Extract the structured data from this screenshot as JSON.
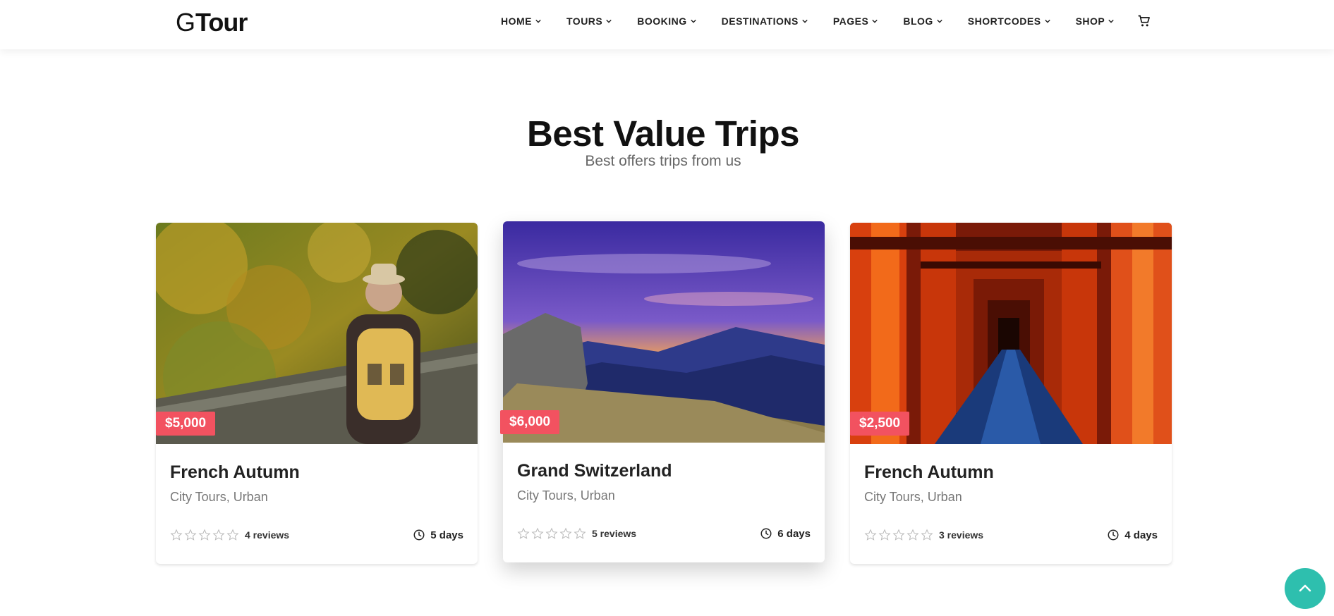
{
  "header": {
    "logo_prefix": "G",
    "logo_suffix": "Tour",
    "nav": [
      "HOME",
      "TOURS",
      "BOOKING",
      "DESTINATIONS",
      "PAGES",
      "BLOG",
      "SHORTCODES",
      "SHOP"
    ],
    "cart_icon": "shopping-cart-icon"
  },
  "section": {
    "title": "Best Value Trips",
    "subtitle": "Best offers trips from us"
  },
  "cards": [
    {
      "price": "$5,000",
      "title": "French Autumn",
      "categories": "City Tours, Urban",
      "rating": 0,
      "reviews": "4 reviews",
      "duration": "5 days",
      "image": "hiker-in-autumn-forest"
    },
    {
      "price": "$6,000",
      "title": "Grand Switzerland",
      "categories": "City Tours, Urban",
      "rating": 0,
      "reviews": "5 reviews",
      "duration": "6 days",
      "image": "mountain-sunset"
    },
    {
      "price": "$2,500",
      "title": "French Autumn",
      "categories": "City Tours, Urban",
      "rating": 0,
      "reviews": "3 reviews",
      "duration": "4 days",
      "image": "torii-gate-tunnel"
    }
  ],
  "colors": {
    "price_badge": "#f25260",
    "back_to_top": "#2ebfae"
  },
  "back_to_top_icon": "chevron-up-icon"
}
